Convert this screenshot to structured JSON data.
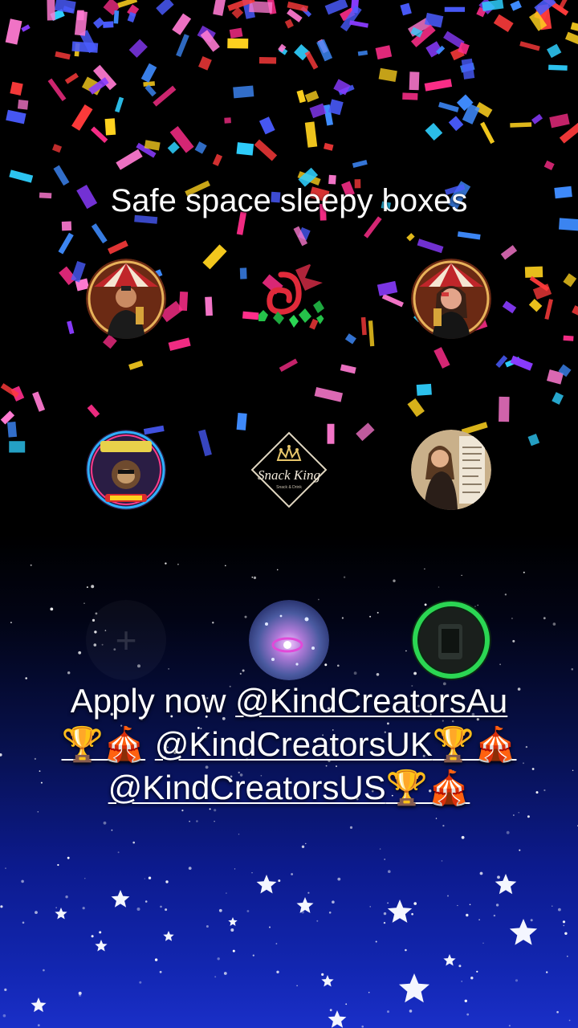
{
  "title": "Safe space sleepy boxes",
  "avatars": [
    {
      "name": "avatar-circus-man",
      "kind": "photo"
    },
    {
      "name": "avatar-green-dragon",
      "kind": "logo"
    },
    {
      "name": "avatar-circus-woman",
      "kind": "photo"
    },
    {
      "name": "avatar-sloth-badge",
      "kind": "logo"
    },
    {
      "name": "avatar-snack-king",
      "kind": "logo",
      "logo_text": "Snack King",
      "logo_sub": "Snack & Drink"
    },
    {
      "name": "avatar-woman-poster",
      "kind": "photo"
    },
    {
      "name": "add-button",
      "kind": "plus",
      "glyph": "+"
    },
    {
      "name": "avatar-galaxy",
      "kind": "logo"
    },
    {
      "name": "avatar-green-ring",
      "kind": "photo"
    }
  ],
  "cta": {
    "prefix": "Apply now ",
    "handle_au": "@KindCreatorsAu",
    "handle_uk": "@KindCreatorsUK",
    "handle_us": "@KindCreatorsUS",
    "emoji": "🏆🎪"
  },
  "colors": {
    "confetti": [
      "#ff2e8a",
      "#3f8cff",
      "#ffd21f",
      "#ff3b3b",
      "#8a3bff",
      "#2fd0ff",
      "#ff7ad1",
      "#4a5cff"
    ],
    "sky_top": "#000000",
    "sky_bottom": "#1a2fc8"
  }
}
